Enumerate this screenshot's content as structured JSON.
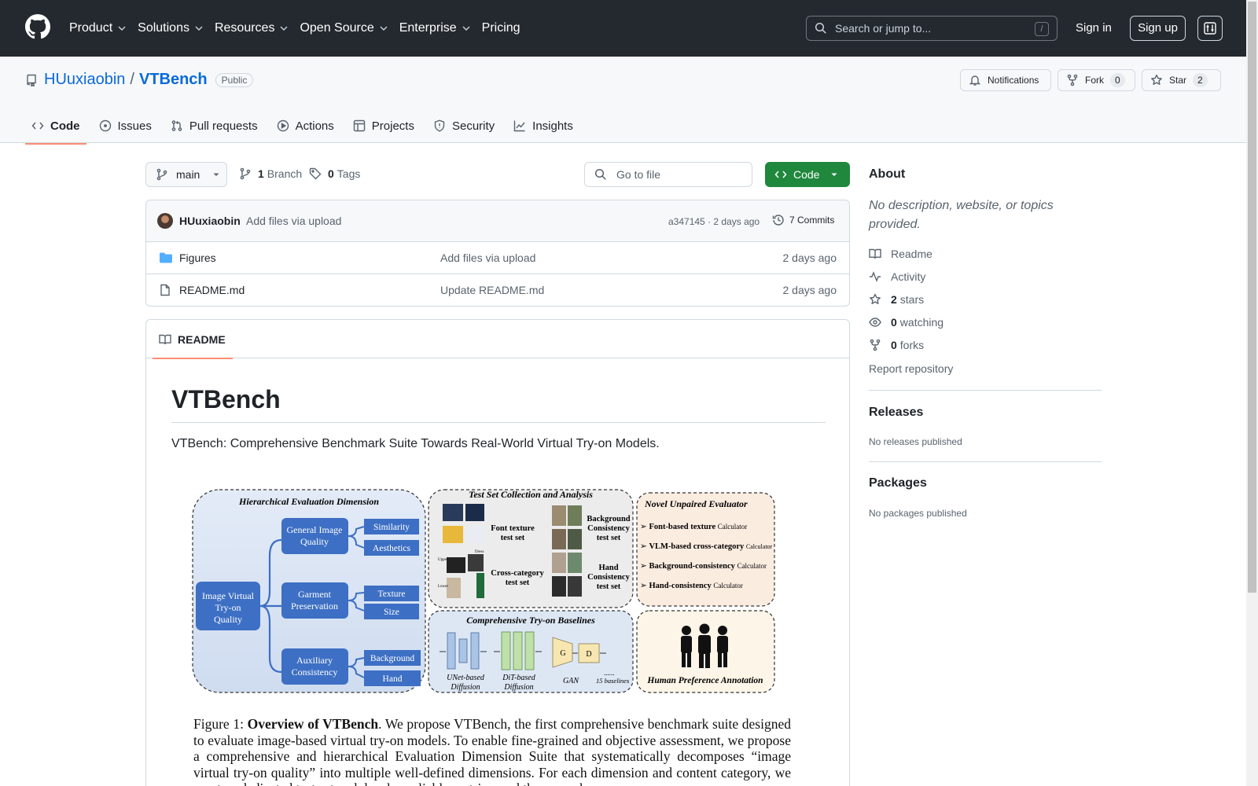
{
  "header": {
    "nav": [
      "Product",
      "Solutions",
      "Resources",
      "Open Source",
      "Enterprise",
      "Pricing"
    ],
    "search_placeholder": "Search or jump to...",
    "search_shortcut": "/",
    "signin": "Sign in",
    "signup": "Sign up"
  },
  "repo": {
    "owner": "HUuxiaobin",
    "separator": "/",
    "name": "VTBench",
    "visibility": "Public",
    "notifications_label": "Notifications",
    "fork_label": "Fork",
    "fork_count": "0",
    "star_label": "Star",
    "star_count": "2",
    "tabs": [
      "Code",
      "Issues",
      "Pull requests",
      "Actions",
      "Projects",
      "Security",
      "Insights"
    ]
  },
  "toolbar": {
    "branch": "main",
    "branch_count": "1",
    "branch_label": "Branch",
    "tag_count": "0",
    "tag_label": "Tags",
    "goto_placeholder": "Go to file",
    "code_button": "Code"
  },
  "commit": {
    "author": "HUuxiaobin",
    "message": "Add files via upload",
    "hash_time": "a347145 · 2 days ago",
    "commits_label": "7 Commits"
  },
  "files": [
    {
      "name": "Figures",
      "type": "folder",
      "message": "Add files via upload",
      "date": "2 days ago"
    },
    {
      "name": "README.md",
      "type": "file",
      "message": "Update README.md",
      "date": "2 days ago"
    }
  ],
  "readme": {
    "tab_label": "README",
    "title": "VTBench",
    "description": "VTBench: Comprehensive Benchmark Suite Towards Real-World Virtual Try-on Models.",
    "figure": {
      "panel1_title": "Hierarchical Evaluation Dimension",
      "root": "Image Virtual Try-on Quality",
      "dims": [
        "General Image Quality",
        "Garment Preservation",
        "Auxiliary Consistency"
      ],
      "leaves": [
        "Similarity",
        "Aesthetics",
        "Texture",
        "Size",
        "Background",
        "Hand"
      ],
      "panel2_title": "Test Set Collection and Analysis",
      "testsets": [
        "Font texture test set",
        "Background Consistency test set",
        "Cross-category test set",
        "Hand Consistency test set"
      ],
      "testset_tags": [
        "Upper",
        "Dress",
        "Lower"
      ],
      "panel3_title": "Novel Unpaired Evaluator",
      "evaluators": [
        {
          "bold": "Font-based texture",
          "rest": "Calculator"
        },
        {
          "bold": "VLM-based cross-category",
          "rest": "Calculator"
        },
        {
          "bold": "Background-consistency",
          "rest": "Calculator"
        },
        {
          "bold": "Hand-consistency",
          "rest": "Calculator"
        }
      ],
      "panel4_title": "Comprehensive Try-on Baselines",
      "baselines": [
        "UNet-based Diffusion",
        "DiT-based Diffusion",
        "GAN",
        "15 baselines"
      ],
      "gan_blocks": [
        "G",
        "D"
      ],
      "ellipsis": "......",
      "panel5_title": "Human Preference Annotation",
      "caption_prefix": "Figure 1: ",
      "caption_bold": "Overview of VTBench",
      "caption_text": ". We propose VTBench, the first comprehensive benchmark suite designed to evaluate image-based virtual try-on models. To enable fine-grained and objective assessment, we propose a comprehensive and hierarchical Evaluation Dimension Suite that systematically decomposes “image virtual try-on quality” into multiple well-defined dimensions. For each dimension and content category, we curate a dedicated test set and develop reliable metrics, and then sample"
    }
  },
  "sidebar": {
    "about_title": "About",
    "about_desc": "No description, website, or topics provided.",
    "readme": "Readme",
    "activity": "Activity",
    "stars_count": "2",
    "stars_label": "stars",
    "watching_count": "0",
    "watching_label": "watching",
    "forks_count": "0",
    "forks_label": "forks",
    "report": "Report repository",
    "releases_title": "Releases",
    "releases_empty": "No releases published",
    "packages_title": "Packages",
    "packages_empty": "No packages published"
  },
  "colors": {
    "header_bg": "#24292f",
    "link": "#0969da",
    "code_button": "#1f883d",
    "tab_underline": "#fd8c73",
    "figure_node": "#3d6fc4",
    "figure_panel": "#dbe4f4"
  }
}
